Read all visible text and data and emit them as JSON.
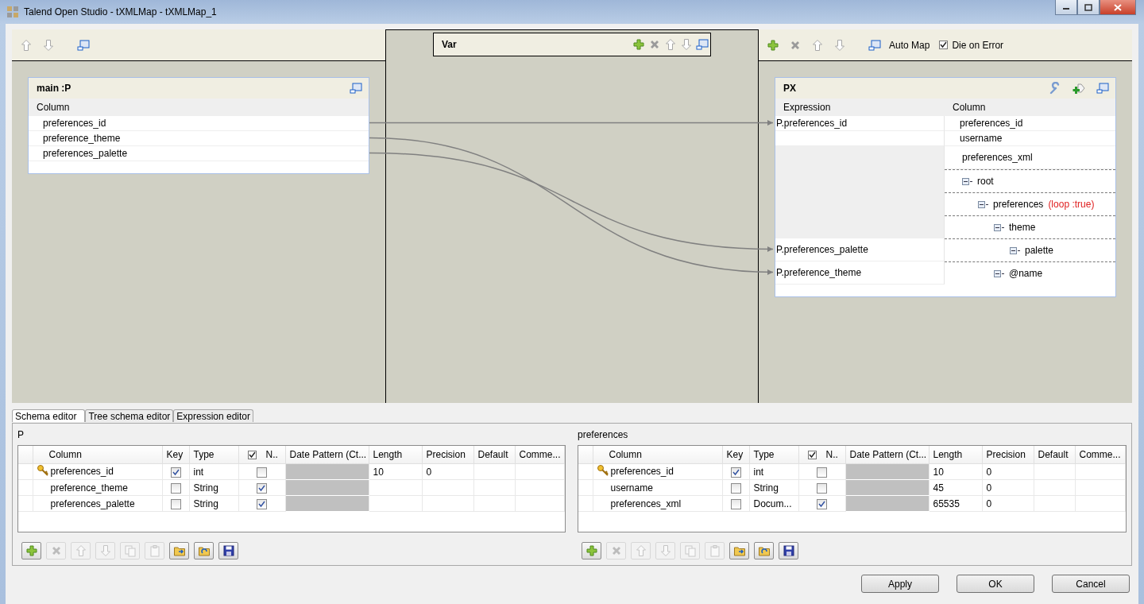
{
  "window": {
    "title": "Talend Open Studio - tXMLMap - tXMLMap_1"
  },
  "input": {
    "title": "main :P",
    "header": "Column",
    "rows": [
      "preferences_id",
      "preference_theme",
      "preferences_palette"
    ]
  },
  "vars": {
    "title": "Var"
  },
  "output_toolbar": {
    "auto_map": "Auto Map",
    "die_on_error": {
      "label": "Die on Error",
      "checked": true
    }
  },
  "output": {
    "title": "PX",
    "headers": [
      "Expression",
      "Column"
    ],
    "rows": [
      {
        "expression": "P.preferences_id",
        "column": "preferences_id"
      },
      {
        "column": "username"
      },
      {
        "column": "preferences_xml",
        "children": [
          {
            "column": "root",
            "children": [
              {
                "column": "preferences",
                "note": "(loop :true)",
                "children": [
                  {
                    "column": "theme",
                    "children": [
                      {
                        "column": "palette",
                        "expression": "P.preferences_palette"
                      }
                    ]
                  },
                  {
                    "column": "@name",
                    "expression": "P.preference_theme"
                  }
                ]
              }
            ]
          }
        ]
      }
    ]
  },
  "tabs": [
    {
      "label": "Schema editor",
      "selected": true
    },
    {
      "label": "Tree schema editor",
      "selected": false
    },
    {
      "label": "Expression editor",
      "selected": false
    }
  ],
  "schemas": [
    {
      "title": "P",
      "columns": [
        "Column",
        "Key",
        "Type",
        "N..",
        "Date Pattern (Ct...",
        "Length",
        "Precision",
        "Default",
        "Comme..."
      ],
      "nullable_all": true,
      "rows": [
        {
          "column": "preferences_id",
          "key": true,
          "type": "int",
          "nullable": false,
          "length": "10",
          "precision": "0"
        },
        {
          "column": "preference_theme",
          "key": false,
          "type": "String",
          "nullable": true
        },
        {
          "column": "preferences_palette",
          "key": false,
          "type": "String",
          "nullable": true
        }
      ]
    },
    {
      "title": "preferences",
      "columns": [
        "Column",
        "Key",
        "Type",
        "N..",
        "Date Pattern (Ct...",
        "Length",
        "Precision",
        "Default",
        "Comme..."
      ],
      "nullable_all": true,
      "rows": [
        {
          "column": "preferences_id",
          "key": true,
          "type": "int",
          "nullable": false,
          "length": "10",
          "precision": "0"
        },
        {
          "column": "username",
          "key": false,
          "type": "String",
          "nullable": false,
          "length": "45",
          "precision": "0"
        },
        {
          "column": "preferences_xml",
          "key": false,
          "type": "Docum...",
          "nullable": true,
          "length": "65535",
          "precision": "0"
        }
      ]
    }
  ],
  "buttons": [
    "Apply",
    "OK",
    "Cancel"
  ]
}
